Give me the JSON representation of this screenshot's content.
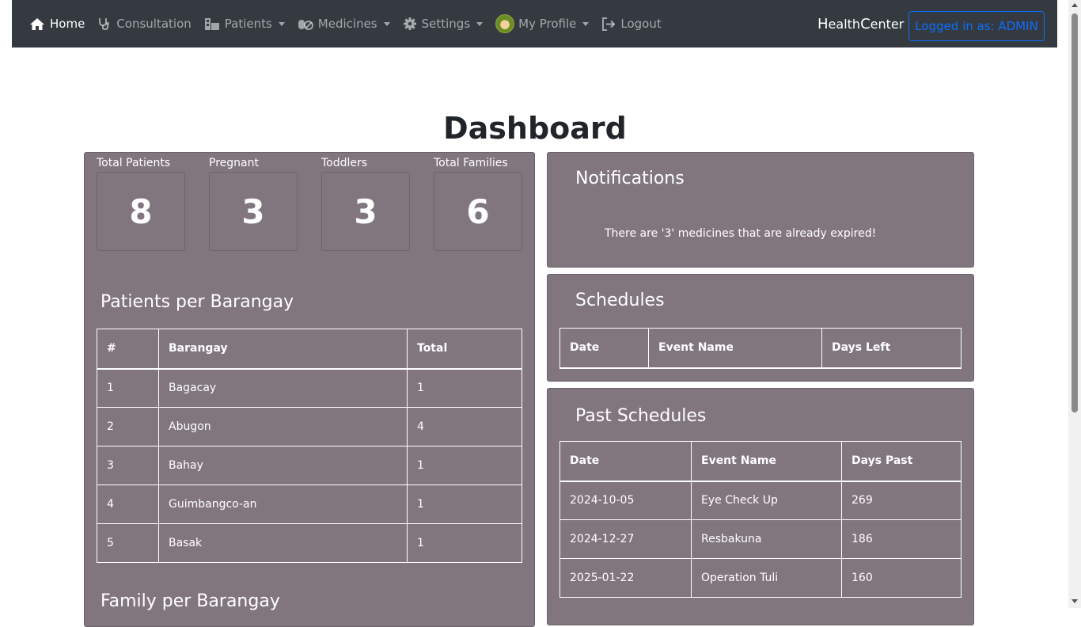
{
  "nav": {
    "home": "Home",
    "consultation": "Consultation",
    "patients": "Patients",
    "medicines": "Medicines",
    "settings": "Settings",
    "profile": "My Profile",
    "logout": "Logout",
    "brand_h": "H",
    "brand_ealth": "ealth",
    "brand_c": "C",
    "brand_enter": "enter",
    "logged_in": "Logged in as: ADMIN"
  },
  "page": {
    "title": "Dashboard"
  },
  "stats": [
    {
      "label": "Total Patients",
      "value": "8"
    },
    {
      "label": "Pregnant",
      "value": "3"
    },
    {
      "label": "Toddlers",
      "value": "3"
    },
    {
      "label": "Total Families",
      "value": "6"
    }
  ],
  "barangay": {
    "title": "Patients per Barangay",
    "headers": [
      "#",
      "Barangay",
      "Total"
    ],
    "rows": [
      [
        "1",
        "Bagacay",
        "1"
      ],
      [
        "2",
        "Abugon",
        "4"
      ],
      [
        "3",
        "Bahay",
        "1"
      ],
      [
        "4",
        "Guimbangco-an",
        "1"
      ],
      [
        "5",
        "Basak",
        "1"
      ]
    ]
  },
  "family": {
    "title": "Family per Barangay"
  },
  "notifications": {
    "title": "Notifications",
    "message": "There are '3' medicines that are already expired!"
  },
  "schedules": {
    "title": "Schedules",
    "headers": [
      "Date",
      "Event Name",
      "Days Left"
    ]
  },
  "past_schedules": {
    "title": "Past Schedules",
    "headers": [
      "Date",
      "Event Name",
      "Days Past"
    ],
    "rows": [
      [
        "2024-10-05",
        "Eye Check Up",
        "269"
      ],
      [
        "2024-12-27",
        "Resbakuna",
        "186"
      ],
      [
        "2025-01-22",
        "Operation Tuli",
        "160"
      ]
    ]
  },
  "colors": {
    "navbar": "#343a40",
    "panel": "#82767e",
    "accent": "#0d6efd"
  }
}
